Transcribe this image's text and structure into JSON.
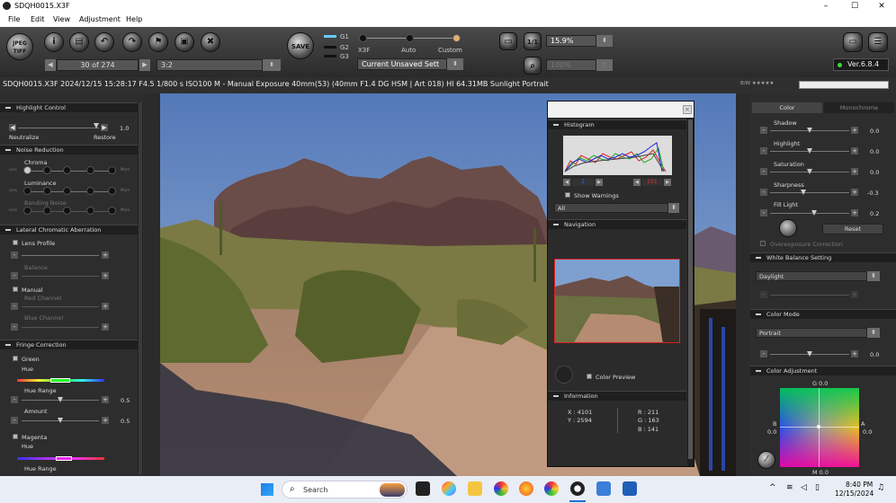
{
  "window": {
    "title": "SDQH0015.X3F",
    "minimize": "–",
    "maximize": "☐",
    "close": "✕"
  },
  "menu": [
    "File",
    "Edit",
    "View",
    "Adjustment",
    "Help"
  ],
  "toolbar": {
    "jpeg_tiff": "JPEG TIFF",
    "save": "SAVE",
    "frame_counter": "30 of 274",
    "aspect": "3:2",
    "g1": "G1",
    "g2": "G2",
    "g3": "G3",
    "x3f": "X3F",
    "auto": "Auto",
    "custom": "Custom",
    "setting": "Current Unsaved Sett",
    "zoom": "15.9%",
    "zoom2": "100%",
    "zoom_1to1": "1/1",
    "version": "Ver.6.8.4"
  },
  "fileinfo": "SDQH0015.X3F 2024/12/15 15:28:17 F4.5 1/800 s ISO100 M - Manual Exposure 40mm(53) (40mm F1.4 DG HSM | Art 018) HI 64.31MB Sunlight Portrait",
  "left_panel": {
    "highlight": {
      "title": "Highlight Control",
      "neutralize": "Neutralize",
      "restore": "Restore",
      "value": "1.0"
    },
    "noise": {
      "title": "Noise Reduction",
      "chroma": "Chroma",
      "luminance": "Luminance",
      "banding": "Banding Noise",
      "less": "Less",
      "more": "More"
    },
    "lca": {
      "title": "Lateral Chromatic Aberration",
      "lens_profile": "Lens Profile",
      "balance": "Balance",
      "manual": "Manual",
      "red": "Red Channel",
      "blue": "Blue Channel"
    },
    "fringe": {
      "title": "Fringe Correction",
      "green": "Green",
      "hue": "Hue",
      "hue_range": "Hue Range",
      "hue_range_val": "0.5",
      "amount": "Amount",
      "amount_val": "0.5",
      "magenta": "Magenta",
      "hue2": "Hue",
      "hue_range2": "Hue Range"
    }
  },
  "float": {
    "histogram": "Histogram",
    "hist_left": "2",
    "hist_right": "251",
    "show_warnings": "Show Warnings",
    "channel": "All",
    "navigation": "Navigation",
    "color_preview": "Color Preview",
    "information": "Information",
    "x": "X : 4101",
    "y": "Y : 2594",
    "r": "R : 211",
    "g": "G : 163",
    "b": "B : 141"
  },
  "right_panel": {
    "tab_color": "Color",
    "tab_mono": "Monochrome",
    "shadow": "Shadow",
    "shadow_val": "0.0",
    "highlight": "Highlight",
    "highlight_val": "0.0",
    "saturation": "Saturation",
    "saturation_val": "0.0",
    "sharpness": "Sharpness",
    "sharpness_val": "-0.3",
    "fill_light": "Fill Light",
    "fill_light_val": "0.2",
    "reset": "Reset",
    "overexposure": "Overexposure Correction",
    "wb_title": "White Balance Setting",
    "wb_value": "Daylight",
    "cm_title": "Color Mode",
    "cm_value": "Portrait",
    "cm_val": "0.0",
    "ca_title": "Color Adjustment",
    "g_label": "G 0.0",
    "b_label": "B",
    "b_val": "0.0",
    "a_label": "A",
    "a_val": "0.0",
    "m_label": "M 0.0",
    "bw_label": "B/W ★★★★★"
  },
  "taskbar": {
    "search": "Search",
    "time": "8:40 PM",
    "date": "12/15/2024"
  }
}
